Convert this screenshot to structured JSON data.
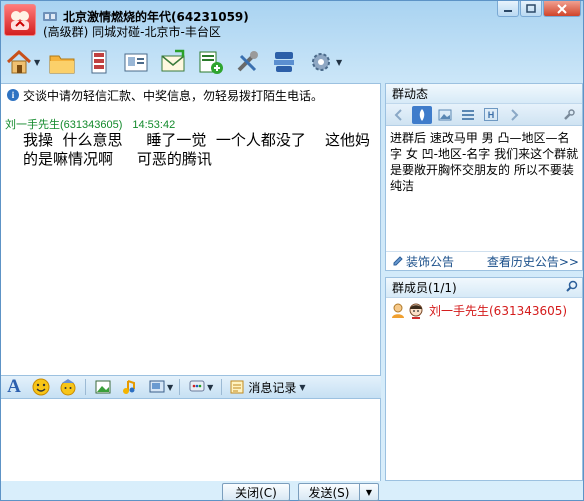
{
  "titlebar": {
    "group_name": "北京激情燃烧的年代(64231059)",
    "subtitle": "(高级群) 同城对碰-北京市-丰台区",
    "controls": [
      "minimize",
      "maximize",
      "close"
    ]
  },
  "toolbar": {
    "buttons": [
      "home-icon",
      "folder-icon",
      "album-icon",
      "card-icon",
      "mail-icon",
      "invite-icon",
      "tools-icon",
      "settings-badge-icon",
      "gear-icon"
    ]
  },
  "chat": {
    "tip": "交谈中请勿轻信汇款、中奖信息，勿轻易拨打陌生电话。",
    "message": {
      "sender": "刘一手先生",
      "sender_id": "(631343605)",
      "time": "14:53:42",
      "text": "我操  什么意思     睡了一觉  一个人都没了    这他妈的是嘛情况啊     可恶的腾讯"
    }
  },
  "input_toolbar": {
    "history_label": "消息记录"
  },
  "buttons": {
    "close_label": "关闭(C)",
    "send_label": "发送(S)"
  },
  "news": {
    "header": "群动态",
    "text": "进群后 速改马甲 男 凸—地区—名字 女 凹-地区-名字  我们来这个群就是要敞开胸怀交朋友的  所以不要装纯洁",
    "decorate_label": "装饰公告",
    "history_label": "查看历史公告>>"
  },
  "members": {
    "header": "群成员(1/1)",
    "list": [
      {
        "name": "刘一手先生(631343605)"
      }
    ]
  },
  "colors": {
    "accent": "#3f7ccb",
    "sender_green": "#128a2b",
    "member_red": "#d41a1a"
  }
}
